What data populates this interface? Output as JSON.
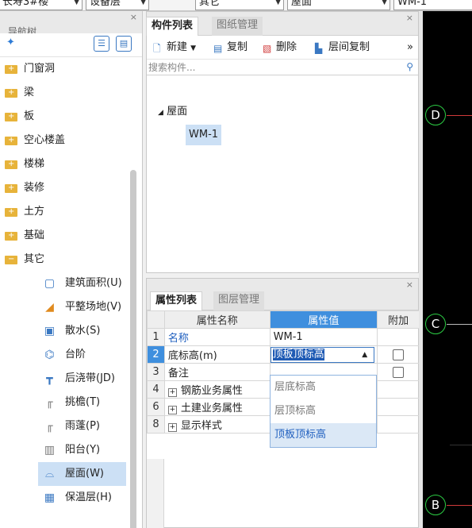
{
  "topbar": {
    "combo1": "长寿3#楼",
    "combo2": "设备层",
    "combo3": "其它",
    "combo4": "屋面",
    "combo5": "WM-1"
  },
  "nav": {
    "title": "导航树",
    "close": "×",
    "list_icon": "list-view-icon",
    "card_icon": "card-view-icon",
    "folders": [
      {
        "label": "门窗洞"
      },
      {
        "label": "梁"
      },
      {
        "label": "板"
      },
      {
        "label": "空心楼盖"
      },
      {
        "label": "楼梯"
      },
      {
        "label": "装修"
      },
      {
        "label": "土方"
      },
      {
        "label": "基础"
      },
      {
        "label": "其它"
      }
    ],
    "children": [
      {
        "label": "建筑面积(U)",
        "icon": "area-icon",
        "glyph": "▢"
      },
      {
        "label": "平整场地(V)",
        "icon": "site-leveling-icon",
        "glyph": "◢"
      },
      {
        "label": "散水(S)",
        "icon": "apron-icon",
        "glyph": "▣"
      },
      {
        "label": "台阶",
        "icon": "steps-icon",
        "glyph": "⌬"
      },
      {
        "label": "后浇带(JD)",
        "icon": "post-pour-strip-icon",
        "glyph": "┳"
      },
      {
        "label": "挑檐(T)",
        "icon": "eaves-icon",
        "glyph": "╓"
      },
      {
        "label": "雨蓬(P)",
        "icon": "canopy-icon",
        "glyph": "╓"
      },
      {
        "label": "阳台(Y)",
        "icon": "balcony-icon",
        "glyph": "▥"
      },
      {
        "label": "屋面(W)",
        "icon": "roof-icon",
        "glyph": "⌓"
      },
      {
        "label": "保温层(H)",
        "icon": "insulation-icon",
        "glyph": "▦"
      }
    ]
  },
  "comp": {
    "close": "×",
    "tab_active": "构件列表",
    "tab_inactive": "图纸管理",
    "toolbar": {
      "new": "新建",
      "copy": "复制",
      "delete": "删除",
      "floor_copy": "层间复制",
      "more": "»"
    },
    "search_placeholder": "搜索构件...",
    "tree_root": "屋面",
    "tree_leaf": "WM-1"
  },
  "prop": {
    "close": "×",
    "tab_active": "属性列表",
    "tab_inactive": "图层管理",
    "headers": {
      "name": "属性名称",
      "value": "属性值",
      "extra": "附加"
    },
    "rows": [
      {
        "num": "1",
        "name": "名称",
        "value": "WM-1"
      },
      {
        "num": "2",
        "name": "底标高(m)",
        "value": "顶板顶标高"
      },
      {
        "num": "3",
        "name": "备注",
        "value": ""
      },
      {
        "num": "4",
        "name": "钢筋业务属性",
        "value": ""
      },
      {
        "num": "6",
        "name": "土建业务属性",
        "value": ""
      },
      {
        "num": "8",
        "name": "显示样式",
        "value": ""
      }
    ],
    "dropdown_options": [
      "层底标高",
      "层顶标高",
      "顶板顶标高"
    ]
  },
  "canvas": {
    "axes": [
      "D",
      "C",
      "B"
    ]
  }
}
